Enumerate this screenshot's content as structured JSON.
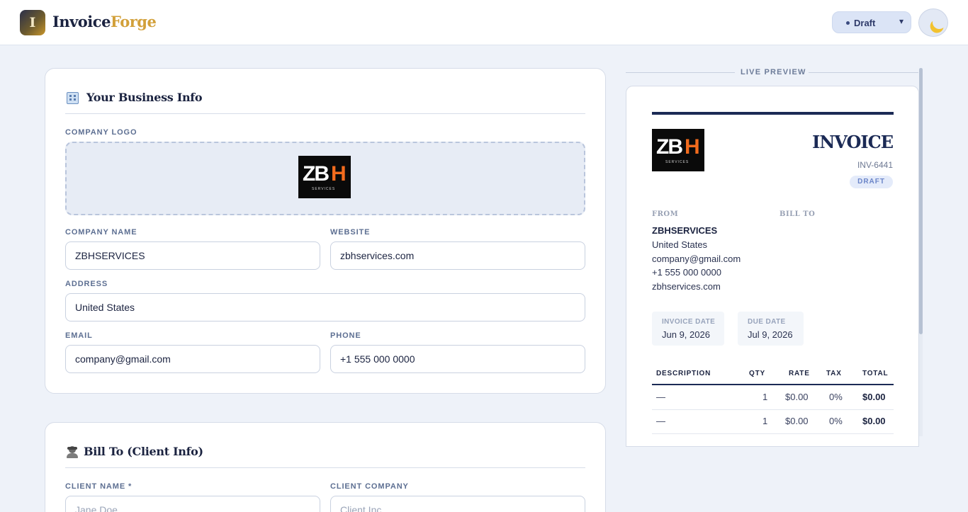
{
  "app": {
    "brand_a": "Invoice",
    "brand_b": "Forge",
    "logo_letter": "I"
  },
  "header": {
    "status_value": "Draft",
    "status_options": [
      "Draft"
    ],
    "theme_icon": "moon-icon"
  },
  "business": {
    "title": "Your Business Info",
    "logo_label": "Company Logo",
    "company_name_label": "Company Name",
    "company_name": "ZBHSERVICES",
    "website_label": "Website",
    "website": "zbhservices.com",
    "address_label": "Address",
    "address": "United States",
    "email_label": "Email",
    "email": "company@gmail.com",
    "phone_label": "Phone",
    "phone": "+1 555 000 0000"
  },
  "client": {
    "title": "Bill To (Client Info)",
    "client_name_label": "Client Name *",
    "client_name_placeholder": "Jane Doe",
    "client_company_label": "Client Company",
    "client_company_placeholder": "Client Inc."
  },
  "logo_image": {
    "text_z": "ZB",
    "text_h": "H",
    "text_sub": "SERVICES"
  },
  "preview": {
    "header": "LIVE PREVIEW",
    "invoice_title": "INVOICE",
    "invoice_number": "INV-6441",
    "status_badge": "DRAFT",
    "from_label": "FROM",
    "bill_to_label": "BILL TO",
    "from_name": "ZBHSERVICES",
    "from_lines": [
      "United States",
      "company@gmail.com",
      "+1 555 000 0000",
      "zbhservices.com"
    ],
    "invoice_date_label": "INVOICE DATE",
    "invoice_date": "Jun 9, 2026",
    "due_date_label": "DUE DATE",
    "due_date": "Jul 9, 2026",
    "table": {
      "headers": [
        "DESCRIPTION",
        "QTY",
        "RATE",
        "TAX",
        "TOTAL"
      ],
      "rows": [
        {
          "description": "—",
          "qty": "1",
          "rate": "$0.00",
          "tax": "0%",
          "total": "$0.00"
        },
        {
          "description": "—",
          "qty": "1",
          "rate": "$0.00",
          "tax": "0%",
          "total": "$0.00"
        }
      ]
    }
  }
}
